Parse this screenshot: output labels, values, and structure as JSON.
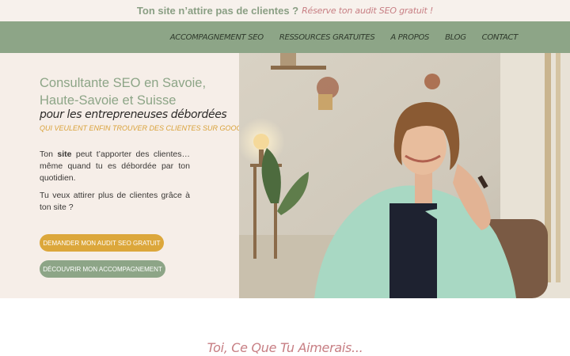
{
  "announcement": {
    "text": "Ton site n’attire pas de clientes ?",
    "link": "Réserve ton audit SEO gratuit !"
  },
  "nav": {
    "items": [
      {
        "label": "Accompagnement SEO"
      },
      {
        "label": "Ressources gratuites"
      },
      {
        "label": "A propos"
      },
      {
        "label": "Blog"
      },
      {
        "label": "Contact"
      }
    ]
  },
  "hero": {
    "title_line1": "Consultante SEO en Savoie,",
    "title_line2": "Haute-Savoie et Suisse",
    "subtitle": "pour les entrepreneuses débordées",
    "tagline": "qui veulent enfin trouver des clientes sur google",
    "para1_prefix": "Ton ",
    "para1_bold": "site",
    "para1_suffix": " peut t’apporter des clientes… même quand tu es débordée par ton quotidien.",
    "para2": "Tu veux attirer plus de clientes grâce à ton site ?",
    "cta_primary": "Demander mon audit SEO gratuit",
    "cta_secondary": "Découvrir mon accompagnement"
  },
  "section": {
    "title": "Toi, Ce Que Tu Aimerais..."
  },
  "colors": {
    "sage": "#8da587",
    "cream": "#f6eee8",
    "mustard": "#dca73b",
    "rose": "#c77e83"
  }
}
